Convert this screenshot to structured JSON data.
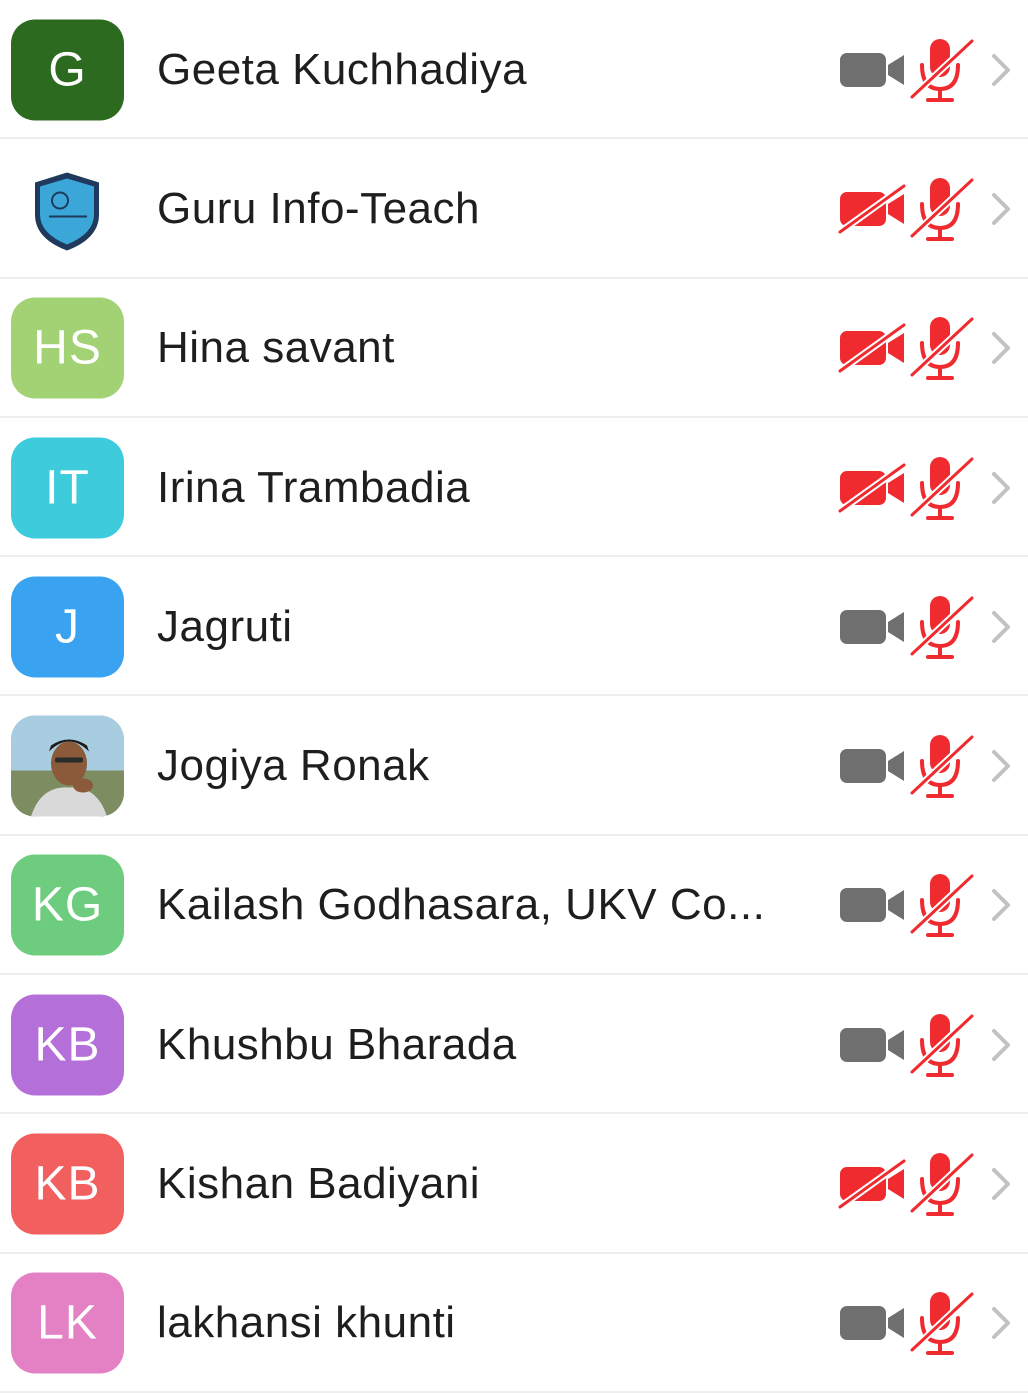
{
  "participants": [
    {
      "name": "Geeta Kuchhadiya",
      "initials": "G",
      "avatar_color": "#2b6a1f",
      "avatar_type": "initials",
      "video_muted": false,
      "audio_muted": true
    },
    {
      "name": "Guru Info-Teach",
      "initials": "",
      "avatar_color": "#ffffff",
      "avatar_type": "logo",
      "video_muted": true,
      "audio_muted": true
    },
    {
      "name": "Hina savant",
      "initials": "HS",
      "avatar_color": "#a3d274",
      "avatar_type": "initials",
      "video_muted": true,
      "audio_muted": true
    },
    {
      "name": "Irina Trambadia",
      "initials": "IT",
      "avatar_color": "#3ecbdc",
      "avatar_type": "initials",
      "video_muted": true,
      "audio_muted": true
    },
    {
      "name": "Jagruti",
      "initials": "J",
      "avatar_color": "#3aa3f1",
      "avatar_type": "initials",
      "video_muted": false,
      "audio_muted": true
    },
    {
      "name": "Jogiya Ronak",
      "initials": "",
      "avatar_color": "#9ec6dc",
      "avatar_type": "photo",
      "video_muted": false,
      "audio_muted": true
    },
    {
      "name": "Kailash Godhasara, UKV Co...",
      "initials": "KG",
      "avatar_color": "#6dcc7e",
      "avatar_type": "initials",
      "video_muted": false,
      "audio_muted": true
    },
    {
      "name": "Khushbu Bharada",
      "initials": "KB",
      "avatar_color": "#b56fd8",
      "avatar_type": "initials",
      "video_muted": false,
      "audio_muted": true
    },
    {
      "name": "Kishan Badiyani",
      "initials": "KB",
      "avatar_color": "#f15f5f",
      "avatar_type": "initials",
      "video_muted": true,
      "audio_muted": true
    },
    {
      "name": "lakhansi khunti",
      "initials": "LK",
      "avatar_color": "#e480c4",
      "avatar_type": "initials",
      "video_muted": false,
      "audio_muted": true
    }
  ],
  "colors": {
    "muted_red": "#ef2b2f",
    "video_on_gray": "#6f6f6f",
    "chevron_gray": "#c2c2c2",
    "divider": "#eeeeee"
  }
}
